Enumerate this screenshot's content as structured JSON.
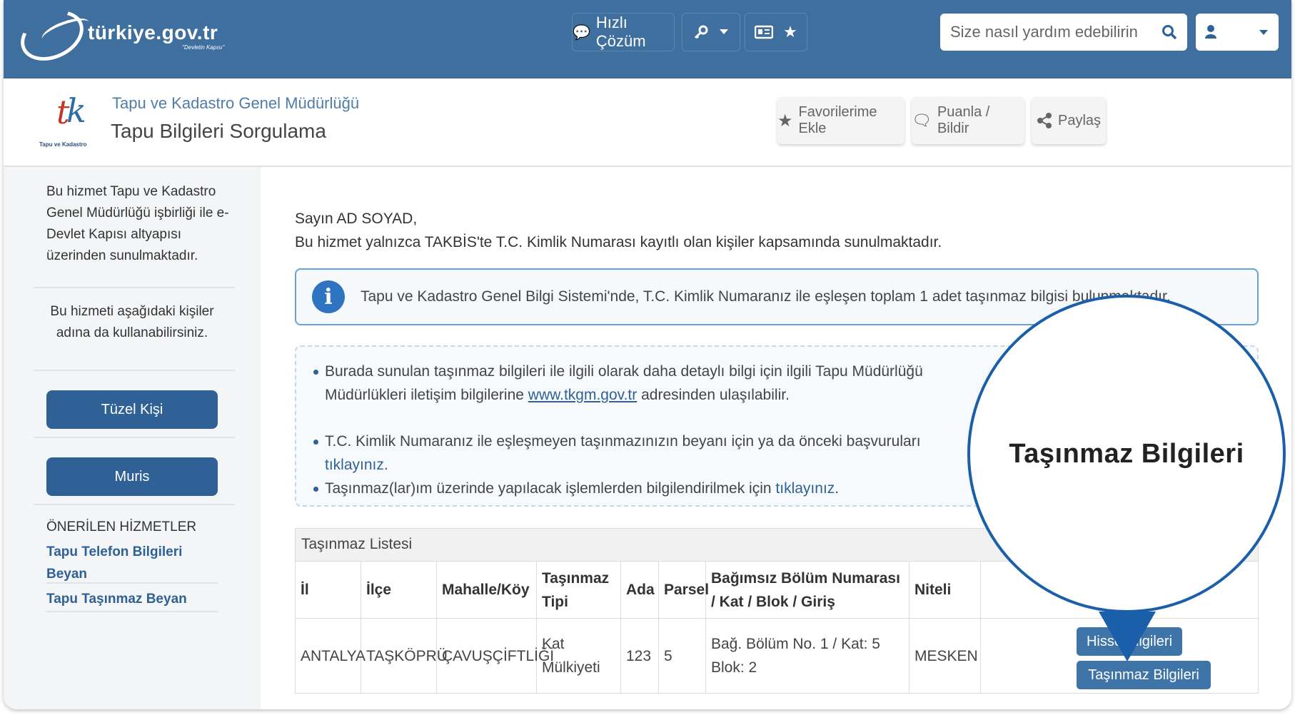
{
  "topbar": {
    "logo_text": "türkiye.gov.tr",
    "logo_sub": "\"Devletin Kapısı\"",
    "quick_solution": "Hızlı Çözüm",
    "search_placeholder": "Size nasıl yardım edebilirin"
  },
  "service": {
    "logo_caption": "Tapu ve Kadastro",
    "organization": "Tapu ve Kadastro Genel Müdürlüğü",
    "title": "Tapu Bilgileri Sorgulama",
    "actions": [
      "Favorilerime Ekle",
      "Puanla / Bildir",
      "Paylaş"
    ]
  },
  "sidebar": {
    "about": "Bu hizmet Tapu ve Kadastro Genel Müdürlüğü işbirliği ile e-Devlet Kapısı altyapısı üzerinden sunulmaktadır.",
    "on_behalf": "Bu hizmeti aşağıdaki kişiler adına da kullanabilirsiniz.",
    "buttons": [
      "Tüzel Kişi",
      "Muris"
    ],
    "recommended_title": "ÖNERİLEN HİZMETLER",
    "recommended": [
      "Tapu Telefon Bilgileri Beyan",
      "Tapu Taşınmaz Beyan"
    ]
  },
  "main": {
    "greeting": "Sayın AD SOYAD,",
    "scope": "Bu hizmet yalnızca TAKBİS'te T.C. Kimlik Numarası kayıtlı olan kişiler kapsamında sunulmaktadır.",
    "info": "Tapu ve Kadastro Genel Bilgi Sistemi'nde, T.C. Kimlik Numaranız ile eşleşen toplam 1 adet taşınmaz bilgisi bulunmaktadır.",
    "notes": {
      "n1a": "Burada sunulan taşınmaz bilgileri ile ilgili olarak daha detaylı bilgi için ilgili Tapu Müdürlüğü",
      "n1b": "Müdürlükleri iletişim bilgilerine",
      "n1_link": "www.tkgm.gov.tr",
      "n1c": "adresinden ulaşılabilir.",
      "n2a": "T.C. Kimlik Numaranız ile eşleşmeyen taşınmazınızın beyanı için ya da önceki başvuruları",
      "n2_link": "tıklayınız",
      "n3a": "Taşınmaz(lar)ım üzerinde yapılacak işlemlerden bilgilendirilmek için",
      "n3_link": "tıklayınız"
    },
    "table": {
      "caption": "Taşınmaz Listesi",
      "headers": [
        "İl",
        "İlçe",
        "Mahalle/Köy",
        "Taşınmaz Tipi",
        "Ada",
        "Parsel",
        "Bağımsız Bölüm Numarası / Kat / Blok / Giriş",
        "Niteli"
      ],
      "row": [
        "ANTALYA",
        "TAŞKÖPRÜ",
        "ÇAVUŞÇİFTLİĞİ",
        "Kat Mülkiyeti",
        "123",
        "5",
        "Bağ. Bölüm No. 1 / Kat: 5 Blok: 2",
        "MESKEN"
      ],
      "btn_hisse": "Hisse Bilgileri",
      "btn_tasinmaz": "Taşınmaz Bilgileri"
    }
  },
  "callout": {
    "label": "Taşınmaz Bilgileri"
  }
}
